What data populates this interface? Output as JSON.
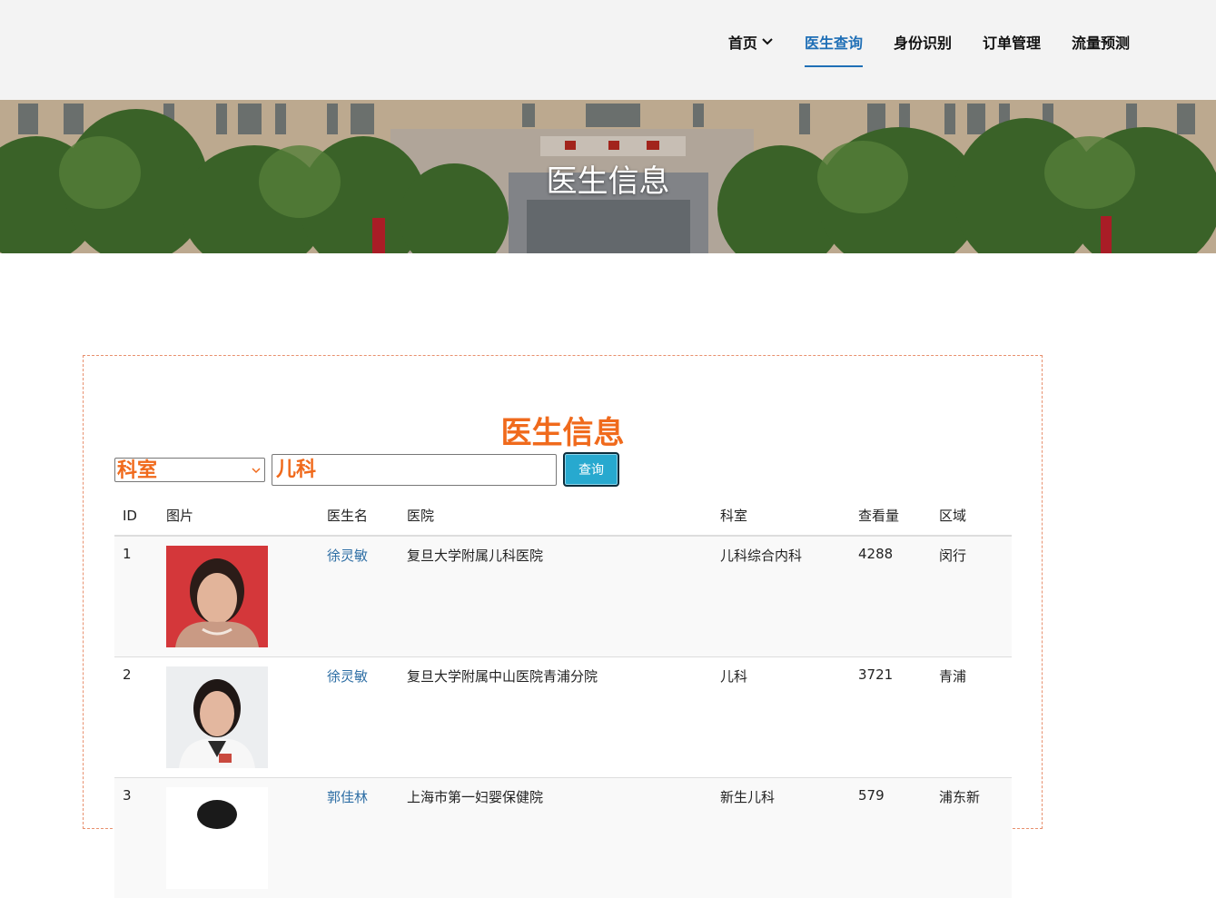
{
  "nav": {
    "items": [
      {
        "label": "首页",
        "has_dropdown": true,
        "active": false
      },
      {
        "label": "医生查询",
        "active": true
      },
      {
        "label": "身份识别",
        "active": false
      },
      {
        "label": "订单管理",
        "active": false
      },
      {
        "label": "流量预测",
        "active": false
      }
    ],
    "active_color": "#1f6fb6"
  },
  "banner": {
    "title": "医生信息"
  },
  "panel": {
    "title": "医生信息",
    "title_color": "#f06a1c",
    "search": {
      "select_value": "科室",
      "input_value": "儿科",
      "button_label": "查询"
    }
  },
  "table": {
    "headers": [
      "ID",
      "图片",
      "医生名",
      "医院",
      "科室",
      "查看量",
      "区域"
    ],
    "rows": [
      {
        "id": "1",
        "name": "徐灵敏",
        "hospital": "复旦大学附属儿科医院",
        "department": "儿科综合内科",
        "views": "4288",
        "region": "闵行"
      },
      {
        "id": "2",
        "name": "徐灵敏",
        "hospital": "复旦大学附属中山医院青浦分院",
        "department": "儿科",
        "views": "3721",
        "region": "青浦"
      },
      {
        "id": "3",
        "name": "郭佳林",
        "hospital": "上海市第一妇婴保健院",
        "department": "新生儿科",
        "views": "579",
        "region": "浦东新"
      }
    ]
  }
}
